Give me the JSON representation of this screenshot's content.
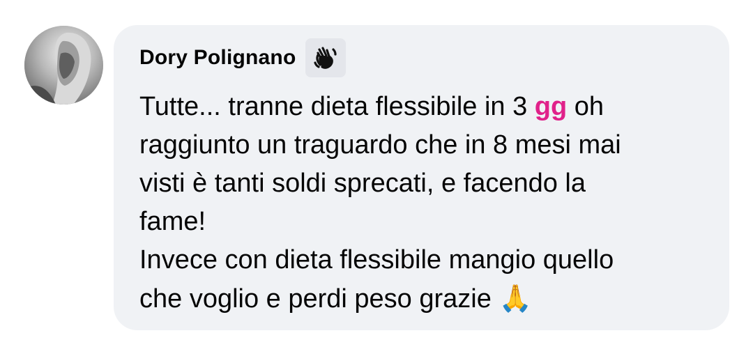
{
  "comment": {
    "author": "Dory Polignano",
    "author_badge_icon": "waving-hand-icon",
    "text_lines": {
      "l1_a": "Tutte... tranne dieta flessibile in 3 ",
      "l1_highlight": "gg",
      "l1_b": " oh",
      "l2": "raggiunto un traguardo che in 8 mesi mai",
      "l3": "visti è tanti soldi sprecati, e facendo la",
      "l4": "fame!",
      "l5": "Invece con dieta flessibile mangio quello",
      "l6": "che voglio e perdi peso grazie "
    },
    "emoji": "🙏",
    "emoji_name": "folded-hands-icon",
    "highlight_color": "#e0218a",
    "bubble_color": "#f0f2f5"
  }
}
